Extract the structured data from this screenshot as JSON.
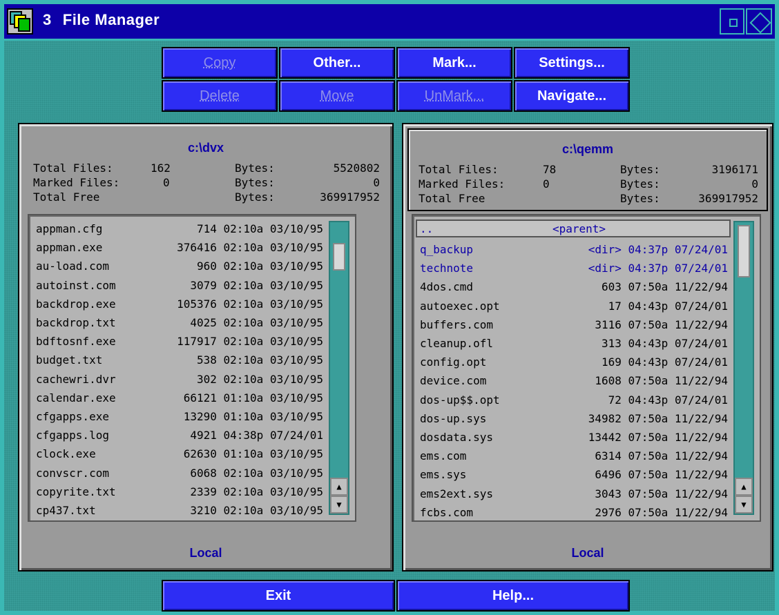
{
  "window": {
    "number": "3",
    "title": "File Manager",
    "colors": {
      "titlebar": "#0d00a8",
      "frame": "#3bb8b4",
      "button": "#2d2df4",
      "panel": "#9a9a9a"
    }
  },
  "toolbar": {
    "copy": "Copy",
    "other": "Other...",
    "mark": "Mark...",
    "settings": "Settings...",
    "delete": "Delete",
    "move": "Move",
    "unmark": "UnMark...",
    "navigate": "Navigate..."
  },
  "left_panel": {
    "path": "c:\\dvx",
    "total_files_label": "Total Files:",
    "total_files": "162",
    "bytes_label": "Bytes:",
    "total_bytes": "5520802",
    "marked_files_label": "Marked Files:",
    "marked_files": "0",
    "marked_bytes": "0",
    "total_free_label": "Total Free",
    "free_bytes": "369917952",
    "location": "Local",
    "files": [
      {
        "name": "appman.cfg",
        "info": "714 02:10a 03/10/95"
      },
      {
        "name": "appman.exe",
        "info": "376416 02:10a 03/10/95"
      },
      {
        "name": "au-load.com",
        "info": "960 02:10a 03/10/95"
      },
      {
        "name": "autoinst.com",
        "info": "3079 02:10a 03/10/95"
      },
      {
        "name": "backdrop.exe",
        "info": "105376 02:10a 03/10/95"
      },
      {
        "name": "backdrop.txt",
        "info": "4025 02:10a 03/10/95"
      },
      {
        "name": "bdftosnf.exe",
        "info": "117917 02:10a 03/10/95"
      },
      {
        "name": "budget.txt",
        "info": "538 02:10a 03/10/95"
      },
      {
        "name": "cachewri.dvr",
        "info": "302 02:10a 03/10/95"
      },
      {
        "name": "calendar.exe",
        "info": "66121 01:10a 03/10/95"
      },
      {
        "name": "cfgapps.exe",
        "info": "13290 01:10a 03/10/95"
      },
      {
        "name": "cfgapps.log",
        "info": "4921 04:38p 07/24/01"
      },
      {
        "name": "clock.exe",
        "info": "62630 01:10a 03/10/95"
      },
      {
        "name": "convscr.com",
        "info": "6068 02:10a 03/10/95"
      },
      {
        "name": "copyrite.txt",
        "info": "2339 02:10a 03/10/95"
      },
      {
        "name": "cp437.txt",
        "info": "3210 02:10a 03/10/95"
      }
    ]
  },
  "right_panel": {
    "path": "c:\\qemm",
    "total_files_label": "Total Files:",
    "total_files": "78",
    "bytes_label": "Bytes:",
    "total_bytes": "3196171",
    "marked_files_label": "Marked Files:",
    "marked_files": "0",
    "marked_bytes": "0",
    "total_free_label": "Total Free",
    "free_bytes": "369917952",
    "location": "Local",
    "parent_name": "..",
    "parent_label": "<parent>",
    "dirs": [
      {
        "name": "q_backup",
        "info": "<dir> 04:37p 07/24/01"
      },
      {
        "name": "technote",
        "info": "<dir> 04:37p 07/24/01"
      }
    ],
    "files": [
      {
        "name": "4dos.cmd",
        "info": "603 07:50a 11/22/94"
      },
      {
        "name": "autoexec.opt",
        "info": "17 04:43p 07/24/01"
      },
      {
        "name": "buffers.com",
        "info": "3116 07:50a 11/22/94"
      },
      {
        "name": "cleanup.ofl",
        "info": "313 04:43p 07/24/01"
      },
      {
        "name": "config.opt",
        "info": "169 04:43p 07/24/01"
      },
      {
        "name": "device.com",
        "info": "1608 07:50a 11/22/94"
      },
      {
        "name": "dos-up$$.opt",
        "info": "72 04:43p 07/24/01"
      },
      {
        "name": "dos-up.sys",
        "info": "34982 07:50a 11/22/94"
      },
      {
        "name": "dosdata.sys",
        "info": "13442 07:50a 11/22/94"
      },
      {
        "name": "ems.com",
        "info": "6314 07:50a 11/22/94"
      },
      {
        "name": "ems.sys",
        "info": "6496 07:50a 11/22/94"
      },
      {
        "name": "ems2ext.sys",
        "info": "3043 07:50a 11/22/94"
      },
      {
        "name": "fcbs.com",
        "info": "2976 07:50a 11/22/94"
      }
    ]
  },
  "footer": {
    "exit": "Exit",
    "help": "Help..."
  }
}
